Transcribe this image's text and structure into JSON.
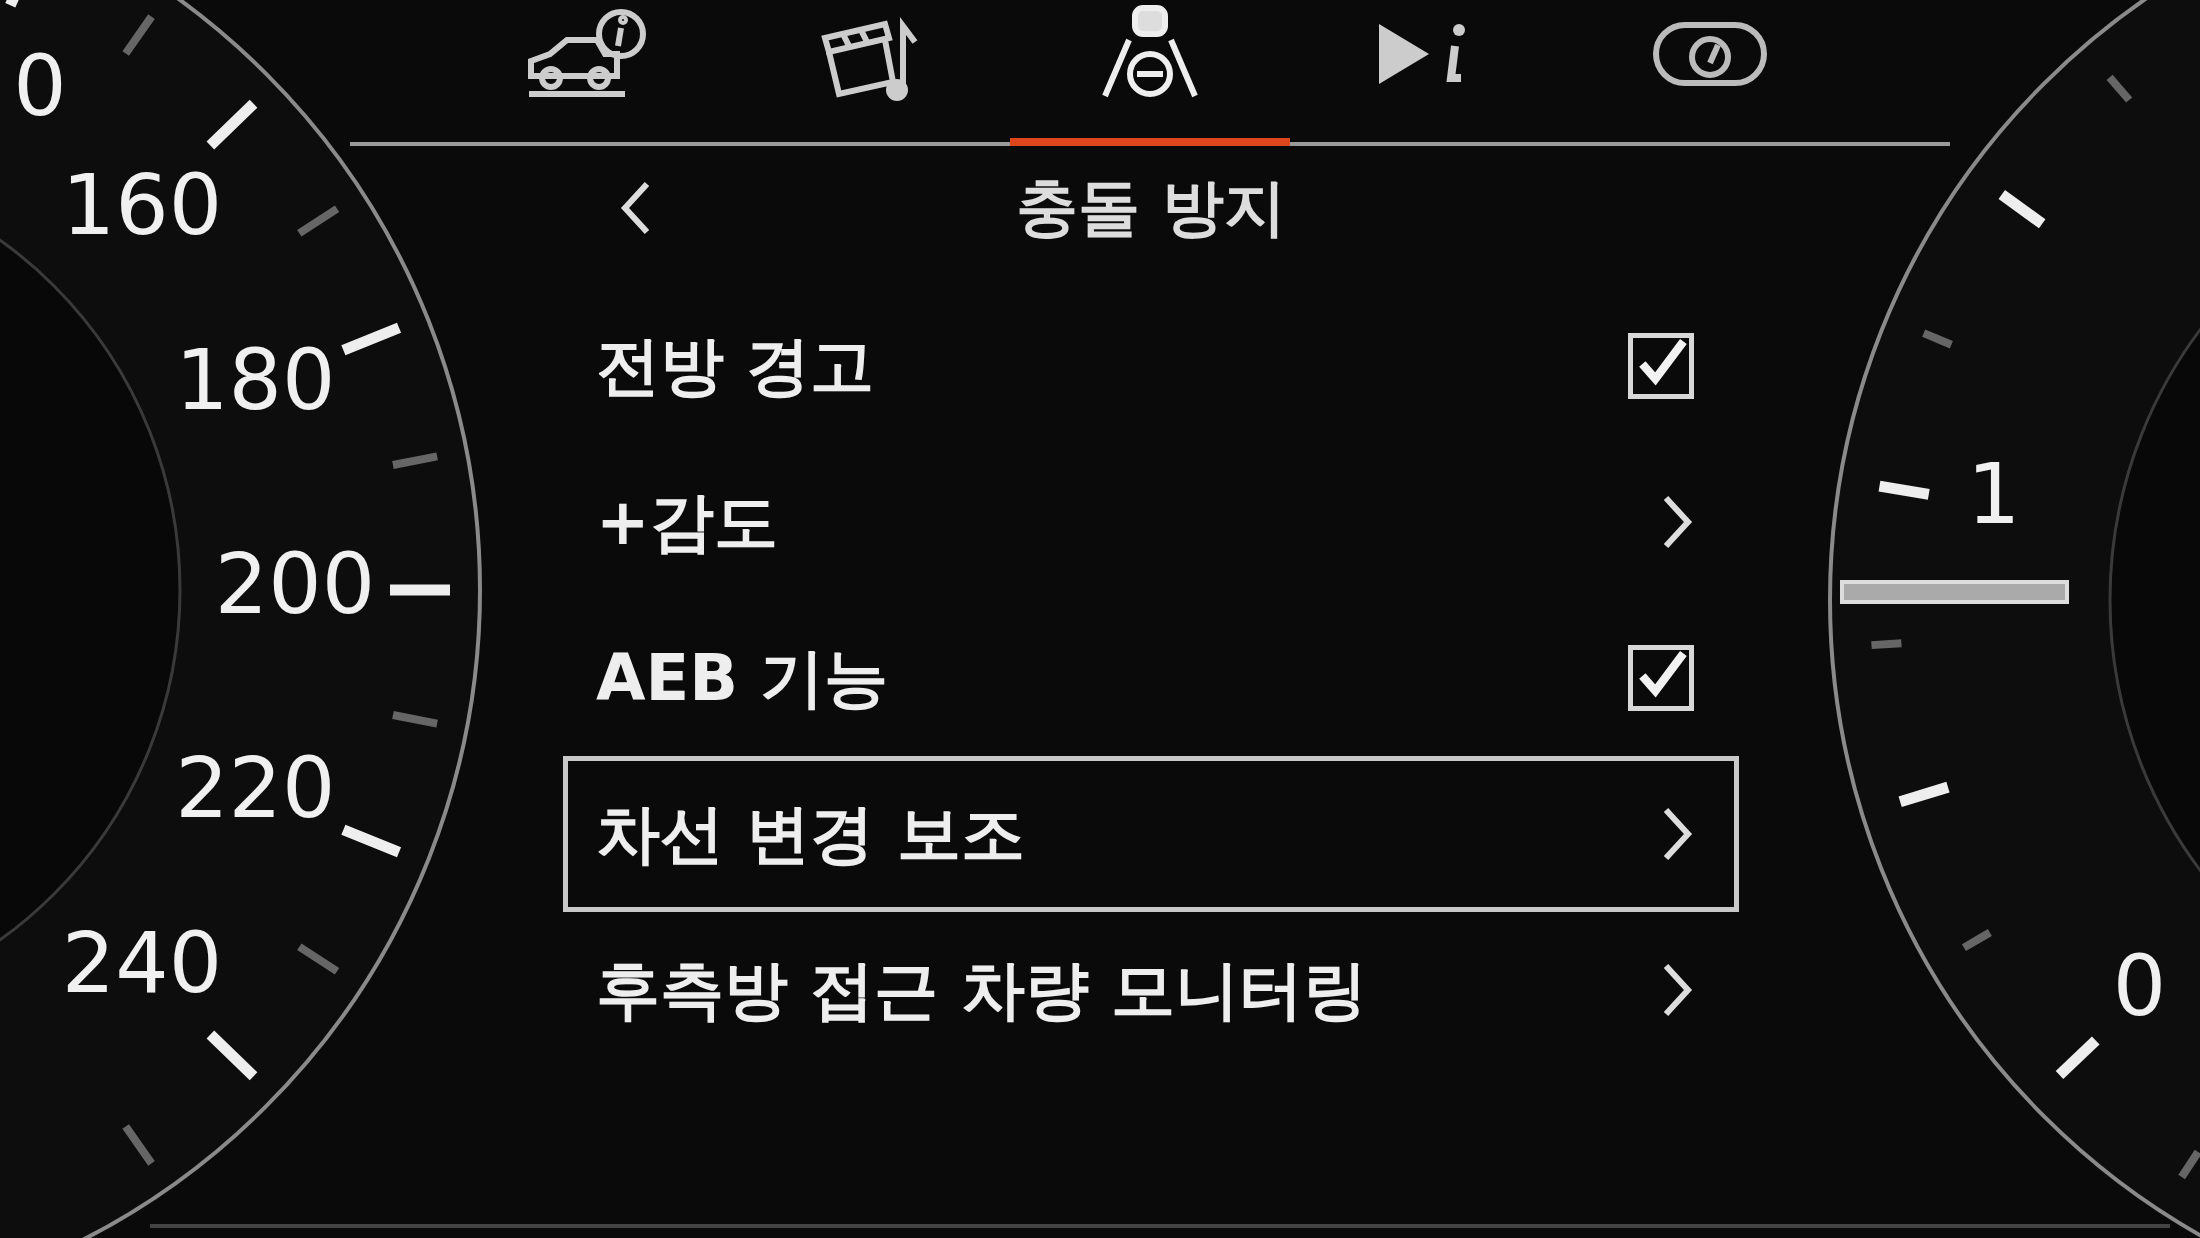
{
  "speedometer": {
    "labels": [
      "0",
      "160",
      "180",
      "200",
      "220",
      "240"
    ]
  },
  "tachometer": {
    "labels": [
      "0",
      "1"
    ]
  },
  "tabs": [
    {
      "kind": "car-info",
      "selected": false
    },
    {
      "kind": "media",
      "selected": false
    },
    {
      "kind": "driver-assist",
      "selected": true
    },
    {
      "kind": "trip-info",
      "selected": false
    },
    {
      "kind": "gauge",
      "selected": false
    }
  ],
  "menu": {
    "title": "충돌 방지",
    "items": [
      {
        "label": "전방 경고",
        "kind": "checkbox",
        "checked": true,
        "selected": false
      },
      {
        "label": "+감도",
        "kind": "submenu",
        "selected": false
      },
      {
        "label": "AEB 기능",
        "kind": "checkbox",
        "checked": true,
        "selected": false
      },
      {
        "label": "차선 변경 보조",
        "kind": "submenu",
        "selected": true
      },
      {
        "label": "후측방 접근 차량 모니터링",
        "kind": "submenu",
        "selected": false
      }
    ]
  }
}
